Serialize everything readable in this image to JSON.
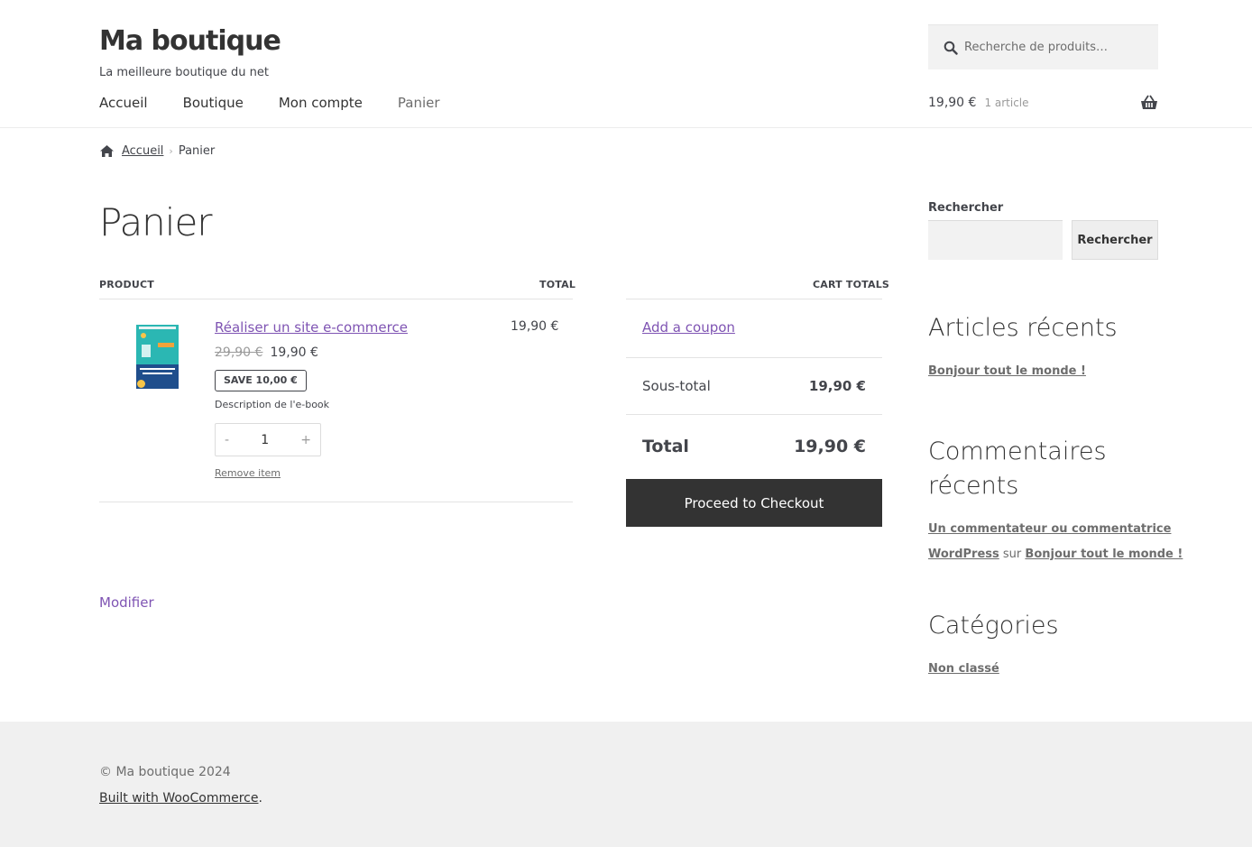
{
  "header": {
    "site_title": "Ma boutique",
    "tagline": "La meilleure boutique du net",
    "search_placeholder": "Recherche de produits…",
    "nav": [
      "Accueil",
      "Boutique",
      "Mon compte",
      "Panier"
    ],
    "mini_cart": {
      "amount": "19,90 €",
      "count": "1 article"
    }
  },
  "breadcrumb": {
    "home": "Accueil",
    "current": "Panier"
  },
  "page_title": "Panier",
  "cart": {
    "headers": {
      "product": "PRODUCT",
      "total": "TOTAL",
      "cart_totals": "CART TOTALS"
    },
    "item": {
      "name": "Réaliser un site e-commerce",
      "old_price": "29,90 €",
      "price": "19,90 €",
      "save": "SAVE 10,00 €",
      "description": "Description de l'e-book",
      "qty_minus": "-",
      "qty": "1",
      "qty_plus": "+",
      "remove": "Remove item",
      "line_total": "19,90 €"
    },
    "coupon": "Add a coupon",
    "subtotal_label": "Sous-total",
    "subtotal_value": "19,90 €",
    "total_label": "Total",
    "total_value": "19,90 €",
    "checkout": "Proceed to Checkout"
  },
  "modify": "Modifier",
  "sidebar": {
    "search_label": "Rechercher",
    "search_button": "Rechercher",
    "recent_posts_title": "Articles récents",
    "recent_post": "Bonjour tout le monde !",
    "recent_comments_title_1": "Commentaires",
    "recent_comments_title_2": "récents",
    "comment_author_1": "Un commentateur ou commentatrice",
    "comment_author_2": "WordPress",
    "comment_sur": "sur",
    "comment_post": "Bonjour tout le monde !",
    "categories_title": "Catégories",
    "category": "Non classé"
  },
  "footer": {
    "copyright": "© Ma boutique 2024",
    "built_with": "Built with WooCommerce",
    "built_suffix": "."
  },
  "colors": {
    "link": "#7f54b3",
    "dark": "#333333",
    "text": "#43454b",
    "footer_bg": "#f0f0f0"
  }
}
